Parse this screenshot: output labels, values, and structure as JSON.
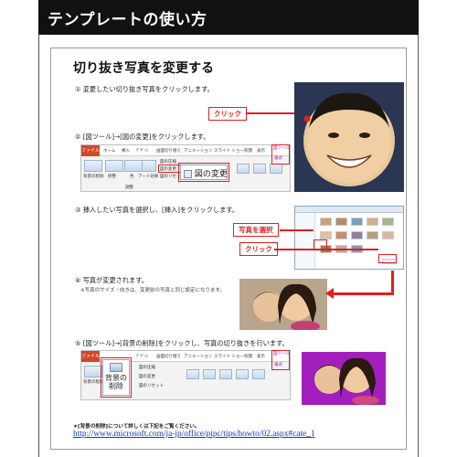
{
  "header": {
    "title": "テンプレートの使い方"
  },
  "section": {
    "title": "切り抜き写真を変更する"
  },
  "steps": [
    "① 変更したい切り抜き写真をクリックします。",
    "② [図ツール]→[図の変更]をクリックします。",
    "③ 挿入したい写真を選択し、[挿入]をクリックします。",
    "④ 写真が変更されます。",
    "⑤ [図ツール]→[背景の削除]をクリックし、写真の切り抜きを行います。"
  ],
  "step4_note": "※写真のサイズ・向きは、変更前の写真と同じ設定になります。",
  "callouts": {
    "click1": "クリック",
    "select_photo": "写真を選択",
    "click2": "クリック"
  },
  "ribbon1": {
    "file_tab": "ファイル",
    "tabs": [
      "ホーム",
      "挿入",
      "ﾃﾞｻﾞｲﾝ",
      "画面切り替え",
      "アニメーション",
      "スライド ショー",
      "校閲",
      "表示"
    ],
    "tool_label": "図ツール",
    "format_tab": "書式",
    "buttons": [
      "背景の削除",
      "修整",
      "色",
      "アート効果"
    ],
    "small_items": [
      "図の圧縮",
      "図の変更",
      "図のリセット"
    ],
    "group_label": "調整",
    "big_button": "図の変更"
  },
  "ribbon2": {
    "file_tab": "ファイル",
    "tabs": [
      "ﾃﾞｻﾞｲﾝ",
      "画面切り替え",
      "アニメーション",
      "スライド ショー",
      "校閲",
      "表示"
    ],
    "tool_label": "図ツール",
    "format_tab": "書式",
    "big_button_line1": "背景の",
    "big_button_line2": "削除",
    "left_label": "背景の削除",
    "small_items": [
      "図の圧縮",
      "図の変更",
      "図のリセット"
    ]
  },
  "footer": {
    "note": "★[背景の削除]について詳しくは下記をご覧ください。",
    "link": "http://www.microsoft.com/ja-jp/office/pipc/tips/howto/02.aspx#cate_1"
  },
  "colors": {
    "accent_red": "#e02020",
    "header_bg": "#111111",
    "link_blue": "#1a33b8"
  }
}
